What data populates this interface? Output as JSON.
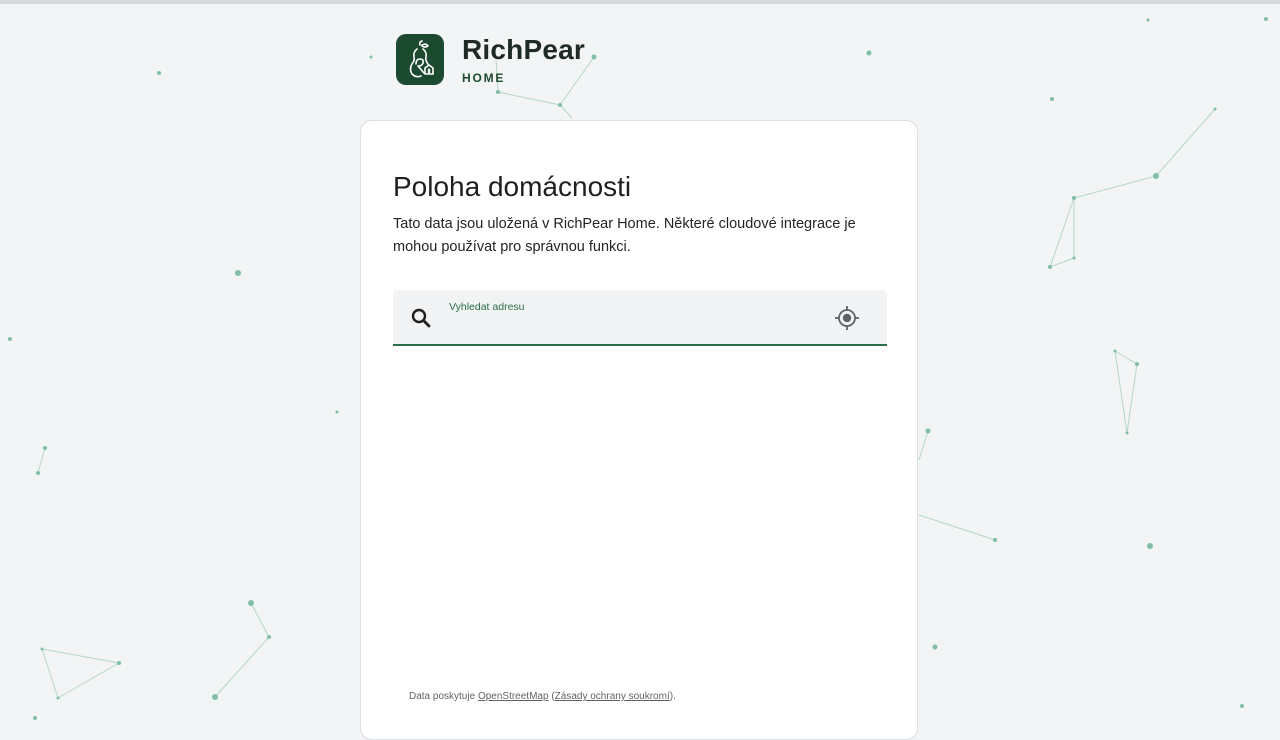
{
  "brand": {
    "name": "RichPear",
    "sub": "HOME"
  },
  "card": {
    "title": "Poloha domácnosti",
    "description": "Tato data jsou uložená v RichPear Home. Některé cloudové integrace je mohou používat pro správnou funkci."
  },
  "search": {
    "label": "Vyhledat adresu",
    "value": ""
  },
  "attribution": {
    "prefix": "Data poskytuje",
    "osm_link": "OpenStreetMap",
    "open_paren": "(",
    "privacy_link": "Zásady ochrany soukromí",
    "close": ")."
  },
  "colors": {
    "accent": "#2b6e4a",
    "logo_bg": "#1c4a2f",
    "background": "#f2f4f5",
    "constellation": "#7fbfa6"
  },
  "icons": {
    "logo": "pear-house-logo",
    "search": "magnifier-icon",
    "locate": "crosshair-location-icon"
  }
}
